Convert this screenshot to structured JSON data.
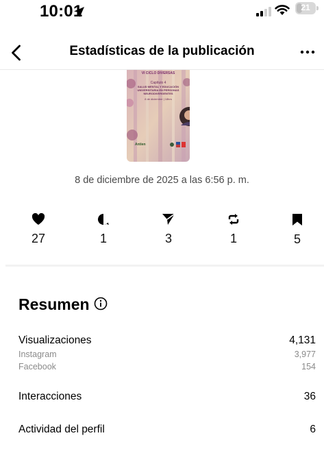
{
  "status_bar": {
    "time": "10:01",
    "battery": "21"
  },
  "header": {
    "title": "Estadísticas de la publicación"
  },
  "post": {
    "date": "8 de diciembre de 2025 a las 6:56 p. m.",
    "image_text": {
      "top": "VI CICLO DIVERSAS",
      "chapter": "Capítulo 4",
      "headline": "SALUD MENTAL Y EDUCACIÓN UNIVERSITARIA EN PERSONAS NEURODIVERGENTES",
      "date": "8 de diciembre | 18hrs",
      "logo_text": "Antien"
    }
  },
  "stats": [
    {
      "icon": "heart-icon",
      "value": "27"
    },
    {
      "icon": "comment-icon",
      "value": "1"
    },
    {
      "icon": "share-icon",
      "value": "3"
    },
    {
      "icon": "repost-icon",
      "value": "1"
    },
    {
      "icon": "bookmark-icon",
      "value": "5"
    }
  ],
  "summary": {
    "title": "Resumen",
    "views": {
      "label": "Visualizaciones",
      "value": "4,131",
      "breakdown": [
        {
          "label": "Instagram",
          "value": "3,977"
        },
        {
          "label": "Facebook",
          "value": "154"
        }
      ]
    },
    "interactions": {
      "label": "Interacciones",
      "value": "36"
    },
    "profile_activity": {
      "label": "Actividad del perfil",
      "value": "6"
    }
  }
}
